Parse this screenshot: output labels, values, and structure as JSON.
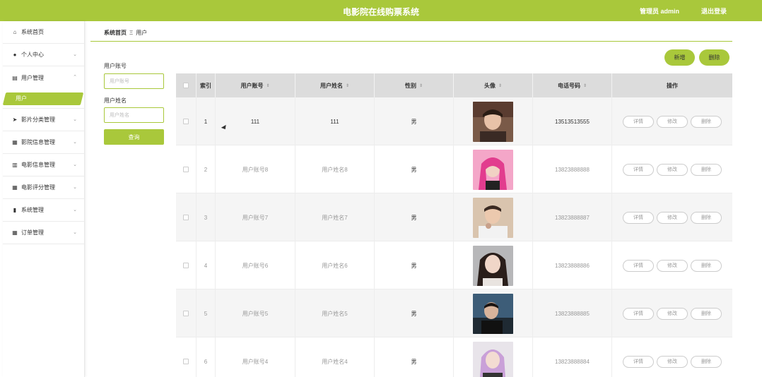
{
  "header": {
    "title": "电影院在线购票系统",
    "admin": "管理员 admin",
    "logout": "退出登录"
  },
  "sidebar": {
    "items": [
      {
        "icon": "home-icon",
        "glyph": "⌂",
        "label": "系统首页",
        "chev": ""
      },
      {
        "icon": "person-icon",
        "glyph": "●",
        "label": "个人中心",
        "chev": "⌄"
      },
      {
        "icon": "clipboard-icon",
        "glyph": "▤",
        "label": "用户管理",
        "chev": "⌃"
      },
      {
        "icon": "send-icon",
        "glyph": "➤",
        "label": "影片分类管理",
        "chev": "⌄"
      },
      {
        "icon": "grid-icon",
        "glyph": "▦",
        "label": "影院信息管理",
        "chev": "⌄"
      },
      {
        "icon": "bar-chart-icon",
        "glyph": "▥",
        "label": "电影信息管理",
        "chev": "⌄"
      },
      {
        "icon": "grid-icon",
        "glyph": "▦",
        "label": "电影评分管理",
        "chev": "⌄"
      },
      {
        "icon": "building-icon",
        "glyph": "▮",
        "label": "系统管理",
        "chev": "⌄"
      },
      {
        "icon": "grid-icon",
        "glyph": "▦",
        "label": "订单管理",
        "chev": "⌄"
      }
    ],
    "sub_item": "用户"
  },
  "breadcrumb": {
    "home": "系统首页",
    "sep": "Ξ",
    "current": "用户"
  },
  "search": {
    "account_label": "用户账号",
    "account_placeholder": "用户账号",
    "name_label": "用户姓名",
    "name_placeholder": "用户姓名",
    "query_button": "查询"
  },
  "actions": {
    "add": "新增",
    "delete": "删除"
  },
  "table": {
    "headers": [
      "",
      "索引",
      "用户账号",
      "用户姓名",
      "性别",
      "头像",
      "电话号码",
      "操作"
    ],
    "rows": [
      {
        "index": "1",
        "account": "111",
        "name": "111",
        "gender": "男",
        "phone": "13513513555"
      },
      {
        "index": "2",
        "account": "用户账号8",
        "name": "用户姓名8",
        "gender": "男",
        "phone": "13823888888"
      },
      {
        "index": "3",
        "account": "用户账号7",
        "name": "用户姓名7",
        "gender": "男",
        "phone": "13823888887"
      },
      {
        "index": "4",
        "account": "用户账号6",
        "name": "用户姓名6",
        "gender": "男",
        "phone": "13823888886"
      },
      {
        "index": "5",
        "account": "用户账号5",
        "name": "用户姓名5",
        "gender": "男",
        "phone": "13823888885"
      },
      {
        "index": "6",
        "account": "用户账号4",
        "name": "用户姓名4",
        "gender": "男",
        "phone": "13823888884"
      }
    ],
    "op_labels": {
      "detail": "详情",
      "edit": "修改",
      "remove": "删除"
    }
  },
  "colors": {
    "accent": "#a9c83b"
  }
}
